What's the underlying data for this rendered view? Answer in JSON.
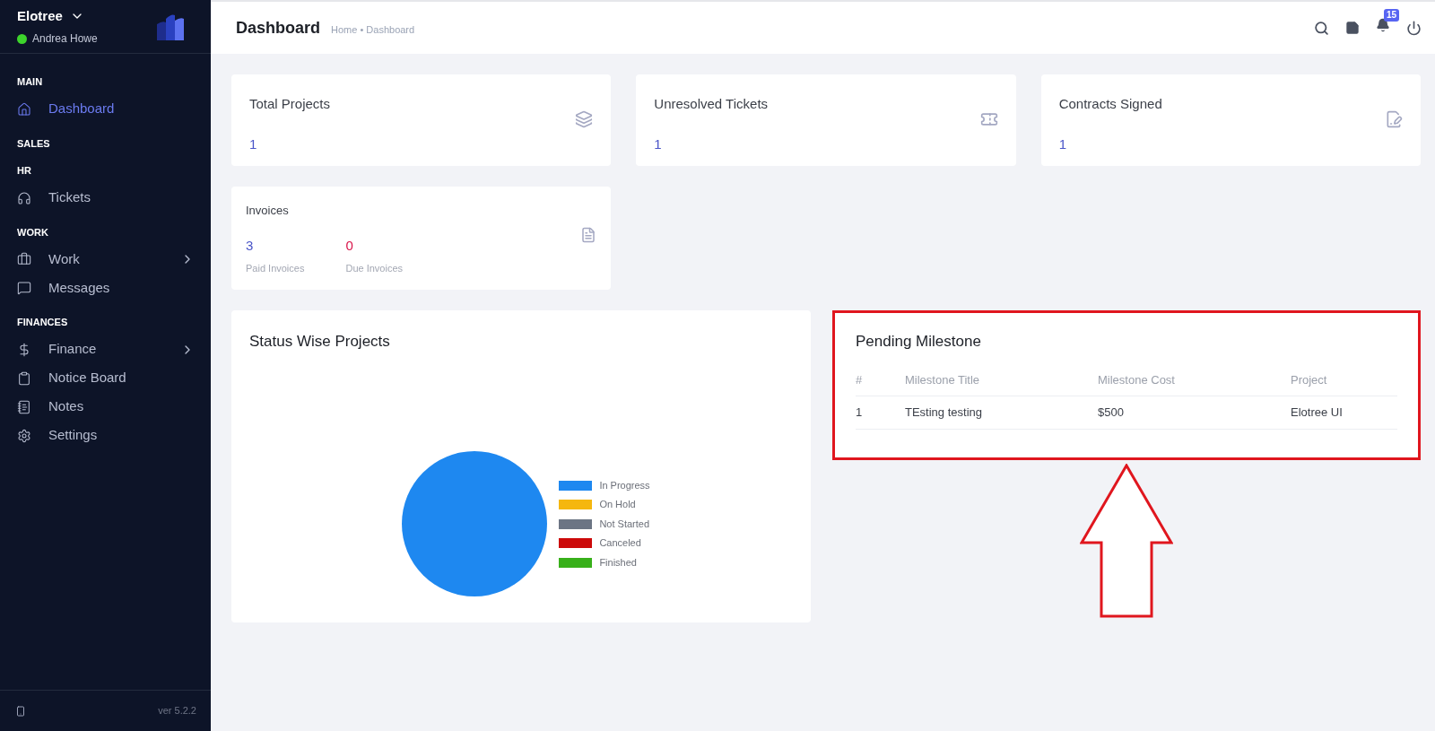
{
  "sidebar": {
    "brand": "Elotree",
    "user": "Andrea Howe",
    "online": true,
    "sections": [
      {
        "title": "MAIN",
        "items": [
          {
            "label": "Dashboard",
            "selected": true,
            "has_submenu": false
          }
        ]
      },
      {
        "title": "SALES"
      },
      {
        "title": "HR",
        "items": [
          {
            "label": "Tickets",
            "selected": false,
            "has_submenu": false
          }
        ]
      },
      {
        "title": "WORK",
        "items": [
          {
            "label": "Work",
            "selected": false,
            "has_submenu": true
          },
          {
            "label": "Messages",
            "selected": false,
            "has_submenu": false
          }
        ]
      },
      {
        "title": "FINANCES",
        "items": [
          {
            "label": "Finance",
            "selected": false,
            "has_submenu": true
          },
          {
            "label": "Notice Board",
            "selected": false,
            "has_submenu": false
          },
          {
            "label": "Notes",
            "selected": false,
            "has_submenu": false
          },
          {
            "label": "Settings",
            "selected": false,
            "has_submenu": false
          }
        ]
      }
    ],
    "version": "ver 5.2.2"
  },
  "header": {
    "title": "Dashboard",
    "breadcrumb": "Home • Dashboard",
    "notification_count": "15"
  },
  "stat_cards": [
    {
      "title": "Total Projects",
      "value": "1"
    },
    {
      "title": "Unresolved Tickets",
      "value": "1"
    },
    {
      "title": "Contracts Signed",
      "value": "1"
    }
  ],
  "invoices": {
    "title": "Invoices",
    "stats": [
      {
        "value": "3",
        "label": "Paid Invoices",
        "color": "#4b56c8"
      },
      {
        "value": "0",
        "label": "Due Invoices",
        "color": "#d9164b"
      }
    ]
  },
  "status_chart": {
    "title": "Status Wise Projects",
    "chart_data": {
      "type": "pie",
      "categories": [
        "In Progress",
        "On Hold",
        "Not Started",
        "Canceled",
        "Finished"
      ],
      "values": [
        1,
        0,
        0,
        0,
        0
      ]
    },
    "legend": [
      {
        "color": "#1e88f0"
      },
      {
        "color": "#f5b70f"
      },
      {
        "color": "#6c7584"
      },
      {
        "color": "#cc0a0a"
      },
      {
        "color": "#38b01a"
      }
    ]
  },
  "milestones": {
    "title": "Pending Milestone",
    "columns": [
      "#",
      "Milestone Title",
      "Milestone Cost",
      "Project"
    ],
    "rows": [
      [
        "1",
        "TEsting testing",
        "$500",
        "Elotree UI"
      ]
    ]
  }
}
